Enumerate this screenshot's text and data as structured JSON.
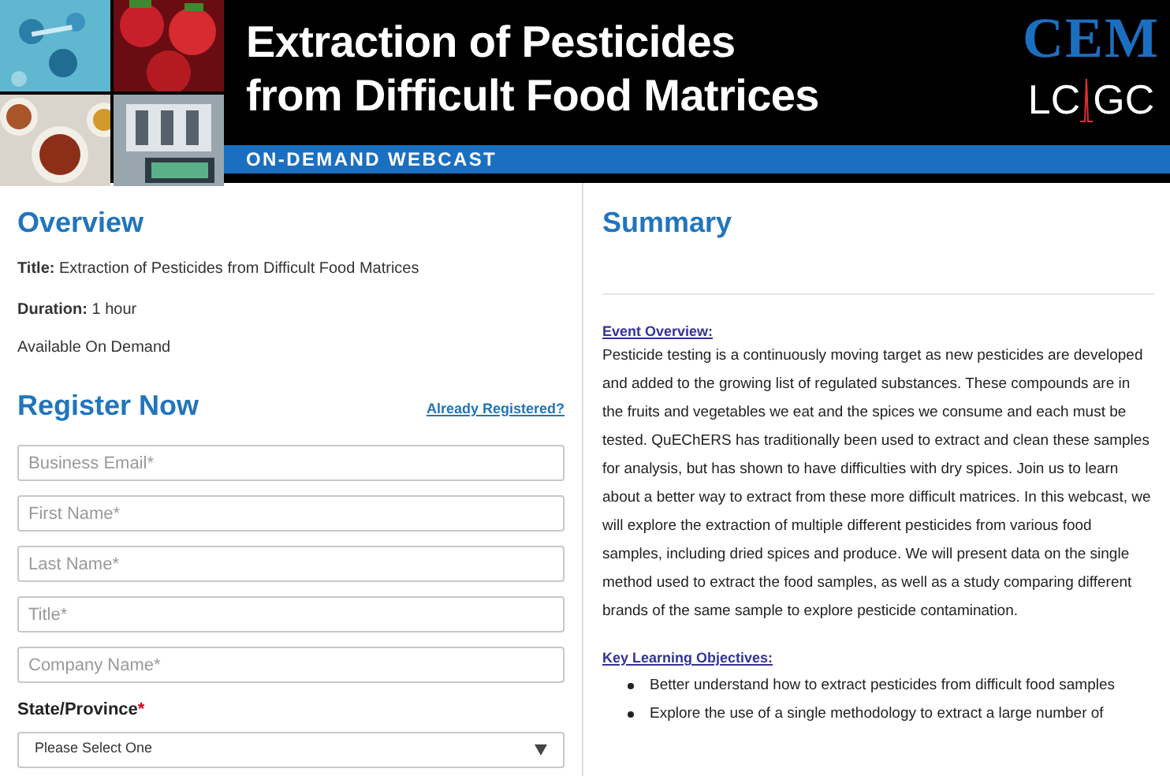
{
  "banner": {
    "title_lines": [
      "Extraction of Pesticides",
      "from Difficult Food Matrices"
    ],
    "subtitle": "ON-DEMAND WEBCAST",
    "logos": [
      "CEM",
      "LC",
      "GC"
    ],
    "photos": [
      {
        "kind": "picture"
      },
      {
        "kind": "picture"
      },
      {
        "kind": "picture"
      },
      {
        "kind": "picture"
      }
    ]
  },
  "overview": {
    "heading": "Overview",
    "details": [
      {
        "label": "Title:",
        "value": "Extraction of Pesticides from Difficult Food Matrices"
      },
      {
        "label": "Duration:",
        "value": "1 hour"
      }
    ],
    "note": "Available On Demand"
  },
  "register": {
    "heading": "Register Now",
    "link": "Already Registered?",
    "fields": [
      {
        "placeholder": "Business Email*"
      },
      {
        "placeholder": "First Name*"
      },
      {
        "placeholder": "Last Name*"
      },
      {
        "placeholder": "Title*"
      },
      {
        "placeholder": "Company Name*"
      }
    ],
    "select_label": "State/Province",
    "required_mark": "*",
    "select_value": "Please Select One"
  },
  "summary": {
    "heading": "Summary",
    "event_heading": "Event Overview:",
    "event_text": "Pesticide testing is a continuously moving target as new pesticides are developed and added to the growing list of regulated substances. These compounds are in the fruits and vegetables we eat and the spices we consume and each must be tested. QuEChERS has traditionally been used to extract and clean these samples for analysis, but has shown to have difficulties with dry spices. Join us to learn about a better way to extract from these more difficult matrices. In this webcast, we will explore the extraction of multiple different pesticides from various food samples, including dried spices and produce. We will present data on the single method used to extract the food samples, as well as a study comparing different brands of the same sample to explore pesticide contamination.",
    "objectives_heading": "Key Learning Objectives:",
    "objectives": [
      "Better understand how to extract pesticides from difficult food samples",
      "Explore the use of a single methodology to extract a large number of"
    ]
  }
}
